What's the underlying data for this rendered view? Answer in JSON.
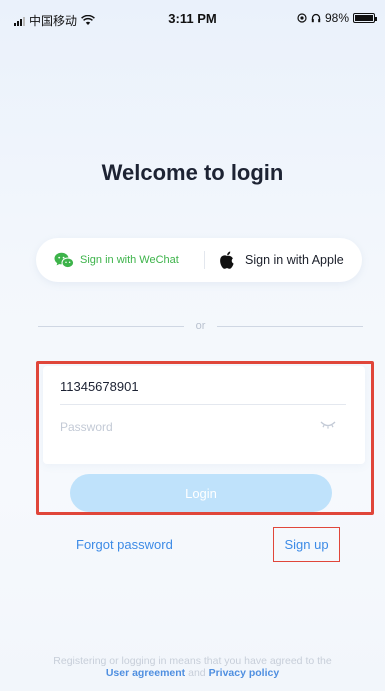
{
  "status_bar": {
    "carrier": "中国移动",
    "time": "3:11 PM",
    "battery": "98%",
    "battery_level": 0.98,
    "icons": [
      "signal-icon",
      "wifi-icon",
      "location-icon",
      "headphones-icon",
      "battery-icon"
    ]
  },
  "title": "Welcome to login",
  "social": {
    "wechat_label": "Sign in with WeChat",
    "apple_label": "Sign in with Apple",
    "wechat_color": "#3db34a"
  },
  "divider_text": "or",
  "form": {
    "phone_value": "11345678901",
    "password_placeholder": "Password",
    "login_label": "Login"
  },
  "links": {
    "forgot": "Forgot password",
    "signup": "Sign up"
  },
  "footer": {
    "line1": "Registering or logging in means that you have agreed to the",
    "agreement": "User agreement",
    "and": "and",
    "privacy": "Privacy policy"
  },
  "colors": {
    "accent": "#3d8be6",
    "login_button": "#bfe2fb",
    "highlight_border": "#e0463a"
  }
}
